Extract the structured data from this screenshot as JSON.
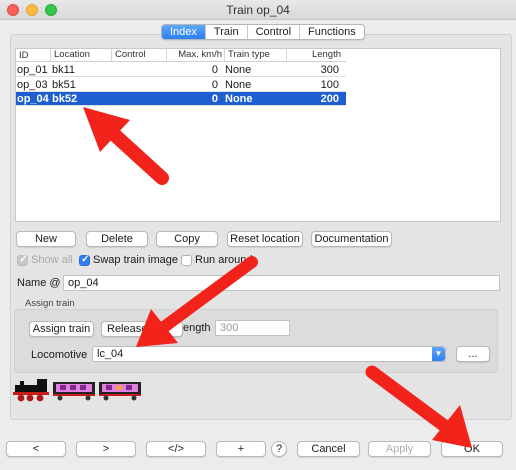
{
  "window": {
    "title": "Train op_04"
  },
  "tabs": [
    {
      "label": "Index",
      "active": true
    },
    {
      "label": "Train",
      "active": false
    },
    {
      "label": "Control",
      "active": false
    },
    {
      "label": "Functions",
      "active": false
    }
  ],
  "table": {
    "columns": [
      "ID",
      "Location",
      "Control",
      "Max. km/h",
      "Train type",
      "Length"
    ],
    "rows": [
      {
        "id": "op_01",
        "location": "bk11",
        "control": "",
        "max_kmh": "0",
        "train_type": "None",
        "length": "300",
        "selected": false
      },
      {
        "id": "op_03",
        "location": "bk51",
        "control": "",
        "max_kmh": "0",
        "train_type": "None",
        "length": "100",
        "selected": false
      },
      {
        "id": "op_04",
        "location": "bk52",
        "control": "",
        "max_kmh": "0",
        "train_type": "None",
        "length": "200",
        "selected": true
      }
    ]
  },
  "actions": {
    "new": "New",
    "delete": "Delete",
    "copy": "Copy",
    "reset_location": "Reset location",
    "documentation": "Documentation"
  },
  "options": {
    "show_all": {
      "label": "Show all",
      "checked": true,
      "enabled": false
    },
    "swap_train_image": {
      "label": "Swap train image",
      "checked": true
    },
    "run_around": {
      "label": "Run around",
      "checked": false
    }
  },
  "name": {
    "label": "Name @",
    "value": "op_04"
  },
  "assign": {
    "title": "Assign train",
    "assign_button": "Assign train",
    "release_button": "Release t",
    "length_label": "ength",
    "length_value": "300",
    "locomotive_label": "Locomotive",
    "locomotive_value": "lc_04",
    "more_button": "..."
  },
  "footer": {
    "prev": "<",
    "next": ">",
    "xml": "</>",
    "add": "+",
    "help": "?",
    "cancel": "Cancel",
    "apply": "Apply",
    "ok": "OK"
  },
  "colors": {
    "selection": "#1d5fd1",
    "accent": "#2a7ff0",
    "annotation_arrow": "#f2231a"
  }
}
